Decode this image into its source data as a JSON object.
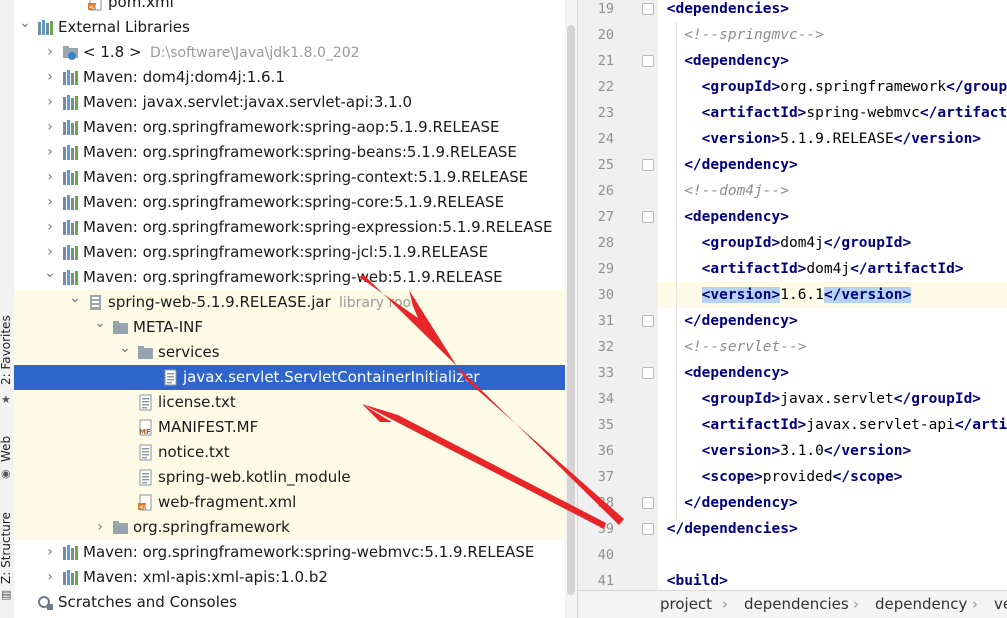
{
  "tree": {
    "rows": [
      {
        "label": "pom.xml",
        "depth": 2,
        "icon": "xml-file-icon",
        "arrow": "none"
      },
      {
        "label": "External Libraries",
        "depth": 0,
        "icon": "library-icon",
        "arrow": "expanded"
      },
      {
        "label": "< 1.8 >",
        "hint": "D:\\software\\Java\\jdk1.8.0_202",
        "depth": 1,
        "icon": "jdk-folder-icon",
        "arrow": "collapsed"
      },
      {
        "label": "Maven: dom4j:dom4j:1.6.1",
        "depth": 1,
        "icon": "library-icon",
        "arrow": "collapsed"
      },
      {
        "label": "Maven: javax.servlet:javax.servlet-api:3.1.0",
        "depth": 1,
        "icon": "library-icon",
        "arrow": "collapsed"
      },
      {
        "label": "Maven: org.springframework:spring-aop:5.1.9.RELEASE",
        "depth": 1,
        "icon": "library-icon",
        "arrow": "collapsed"
      },
      {
        "label": "Maven: org.springframework:spring-beans:5.1.9.RELEASE",
        "depth": 1,
        "icon": "library-icon",
        "arrow": "collapsed"
      },
      {
        "label": "Maven: org.springframework:spring-context:5.1.9.RELEASE",
        "depth": 1,
        "icon": "library-icon",
        "arrow": "collapsed"
      },
      {
        "label": "Maven: org.springframework:spring-core:5.1.9.RELEASE",
        "depth": 1,
        "icon": "library-icon",
        "arrow": "collapsed"
      },
      {
        "label": "Maven: org.springframework:spring-expression:5.1.9.RELEASE",
        "depth": 1,
        "icon": "library-icon",
        "arrow": "collapsed"
      },
      {
        "label": "Maven: org.springframework:spring-jcl:5.1.9.RELEASE",
        "depth": 1,
        "icon": "library-icon",
        "arrow": "collapsed"
      },
      {
        "label": "Maven: org.springframework:spring-web:5.1.9.RELEASE",
        "depth": 1,
        "icon": "library-icon",
        "arrow": "expanded"
      },
      {
        "label": "spring-web-5.1.9.RELEASE.jar",
        "hint": "library root",
        "depth": 2,
        "icon": "jar-icon",
        "arrow": "expanded",
        "highlight": true
      },
      {
        "label": "META-INF",
        "depth": 3,
        "icon": "folder-icon",
        "arrow": "expanded",
        "highlight": true
      },
      {
        "label": "services",
        "depth": 4,
        "icon": "folder-icon",
        "arrow": "expanded",
        "highlight": true
      },
      {
        "label": "javax.servlet.ServletContainerInitializer",
        "depth": 5,
        "icon": "text-file-icon",
        "arrow": "none",
        "selected": true
      },
      {
        "label": "license.txt",
        "depth": 4,
        "icon": "text-file-icon",
        "arrow": "none",
        "highlight": true
      },
      {
        "label": "MANIFEST.MF",
        "depth": 4,
        "icon": "manifest-icon",
        "arrow": "none",
        "highlight": true
      },
      {
        "label": "notice.txt",
        "depth": 4,
        "icon": "text-file-icon",
        "arrow": "none",
        "highlight": true
      },
      {
        "label": "spring-web.kotlin_module",
        "depth": 4,
        "icon": "text-file-icon",
        "arrow": "none",
        "highlight": true
      },
      {
        "label": "web-fragment.xml",
        "depth": 4,
        "icon": "xml-file-icon",
        "arrow": "none",
        "highlight": true
      },
      {
        "label": "org.springframework",
        "depth": 3,
        "icon": "folder-icon",
        "arrow": "collapsed",
        "highlight": true
      },
      {
        "label": "Maven: org.springframework:spring-webmvc:5.1.9.RELEASE",
        "depth": 1,
        "icon": "library-icon",
        "arrow": "collapsed"
      },
      {
        "label": "Maven: xml-apis:xml-apis:1.0.b2",
        "depth": 1,
        "icon": "library-icon",
        "arrow": "collapsed"
      },
      {
        "label": "Scratches and Consoles",
        "depth": 0,
        "icon": "scratches-icon",
        "arrow": "none"
      }
    ]
  },
  "toolstrip": {
    "favorites": "2: Favorites",
    "web": "Web",
    "structure": "Z: Structure"
  },
  "editor": {
    "lines": [
      {
        "n": "19",
        "indent": 0,
        "parts": [
          [
            "t",
            "<dependencies>"
          ]
        ],
        "fold": true
      },
      {
        "n": "20",
        "indent": 1,
        "parts": [
          [
            "c",
            "<!--springmvc-->"
          ]
        ]
      },
      {
        "n": "21",
        "indent": 1,
        "parts": [
          [
            "t",
            "<dependency>"
          ]
        ],
        "fold": true
      },
      {
        "n": "22",
        "indent": 2,
        "parts": [
          [
            "t",
            "<groupId>"
          ],
          [
            "x",
            "org.springframework"
          ],
          [
            "t",
            "</groupId>"
          ]
        ]
      },
      {
        "n": "23",
        "indent": 2,
        "parts": [
          [
            "t",
            "<artifactId>"
          ],
          [
            "x",
            "spring-webmvc"
          ],
          [
            "t",
            "</artifactId>"
          ]
        ]
      },
      {
        "n": "24",
        "indent": 2,
        "parts": [
          [
            "t",
            "<version>"
          ],
          [
            "x",
            "5.1.9.RELEASE"
          ],
          [
            "t",
            "</version>"
          ]
        ]
      },
      {
        "n": "25",
        "indent": 1,
        "parts": [
          [
            "t",
            "</dependency>"
          ]
        ],
        "fold": true
      },
      {
        "n": "26",
        "indent": 1,
        "parts": [
          [
            "c",
            "<!--dom4j-->"
          ]
        ]
      },
      {
        "n": "27",
        "indent": 1,
        "parts": [
          [
            "t",
            "<dependency>"
          ]
        ],
        "fold": true
      },
      {
        "n": "28",
        "indent": 2,
        "parts": [
          [
            "t",
            "<groupId>"
          ],
          [
            "x",
            "dom4j"
          ],
          [
            "t",
            "</groupId>"
          ]
        ]
      },
      {
        "n": "29",
        "indent": 2,
        "parts": [
          [
            "t",
            "<artifactId>"
          ],
          [
            "x",
            "dom4j"
          ],
          [
            "t",
            "</artifactId>"
          ]
        ]
      },
      {
        "n": "30",
        "indent": 2,
        "parts": [
          [
            "h",
            "<version>"
          ],
          [
            "x",
            "1.6.1"
          ],
          [
            "h",
            "</version>"
          ]
        ],
        "current": true
      },
      {
        "n": "31",
        "indent": 1,
        "parts": [
          [
            "t",
            "</dependency>"
          ]
        ],
        "fold": true
      },
      {
        "n": "32",
        "indent": 1,
        "parts": [
          [
            "c",
            "<!--servlet-->"
          ]
        ]
      },
      {
        "n": "33",
        "indent": 1,
        "parts": [
          [
            "t",
            "<dependency>"
          ]
        ],
        "fold": true
      },
      {
        "n": "34",
        "indent": 2,
        "parts": [
          [
            "t",
            "<groupId>"
          ],
          [
            "x",
            "javax.servlet"
          ],
          [
            "t",
            "</groupId>"
          ]
        ]
      },
      {
        "n": "35",
        "indent": 2,
        "parts": [
          [
            "t",
            "<artifactId>"
          ],
          [
            "x",
            "javax.servlet-api"
          ],
          [
            "t",
            "</artifactId>"
          ]
        ]
      },
      {
        "n": "36",
        "indent": 2,
        "parts": [
          [
            "t",
            "<version>"
          ],
          [
            "x",
            "3.1.0"
          ],
          [
            "t",
            "</version>"
          ]
        ]
      },
      {
        "n": "37",
        "indent": 2,
        "parts": [
          [
            "t",
            "<scope>"
          ],
          [
            "x",
            "provided"
          ],
          [
            "t",
            "</scope>"
          ]
        ]
      },
      {
        "n": "38",
        "indent": 1,
        "parts": [
          [
            "t",
            "</dependency>"
          ]
        ],
        "fold": true
      },
      {
        "n": "39",
        "indent": 0,
        "parts": [
          [
            "t",
            "</dependencies>"
          ]
        ],
        "fold": true
      },
      {
        "n": "40",
        "indent": 0,
        "parts": []
      },
      {
        "n": "41",
        "indent": 0,
        "parts": [
          [
            "t",
            "<build>"
          ]
        ]
      }
    ]
  },
  "breadcrumb": {
    "items": [
      "project",
      "dependencies",
      "dependency",
      "ve"
    ]
  },
  "colors": {
    "selection": "#2f65ca",
    "highlight_row": "#fdfbe6",
    "tag": "#00007f",
    "comment": "#8c8c8c",
    "annotation_arrow": "#e8262a"
  }
}
